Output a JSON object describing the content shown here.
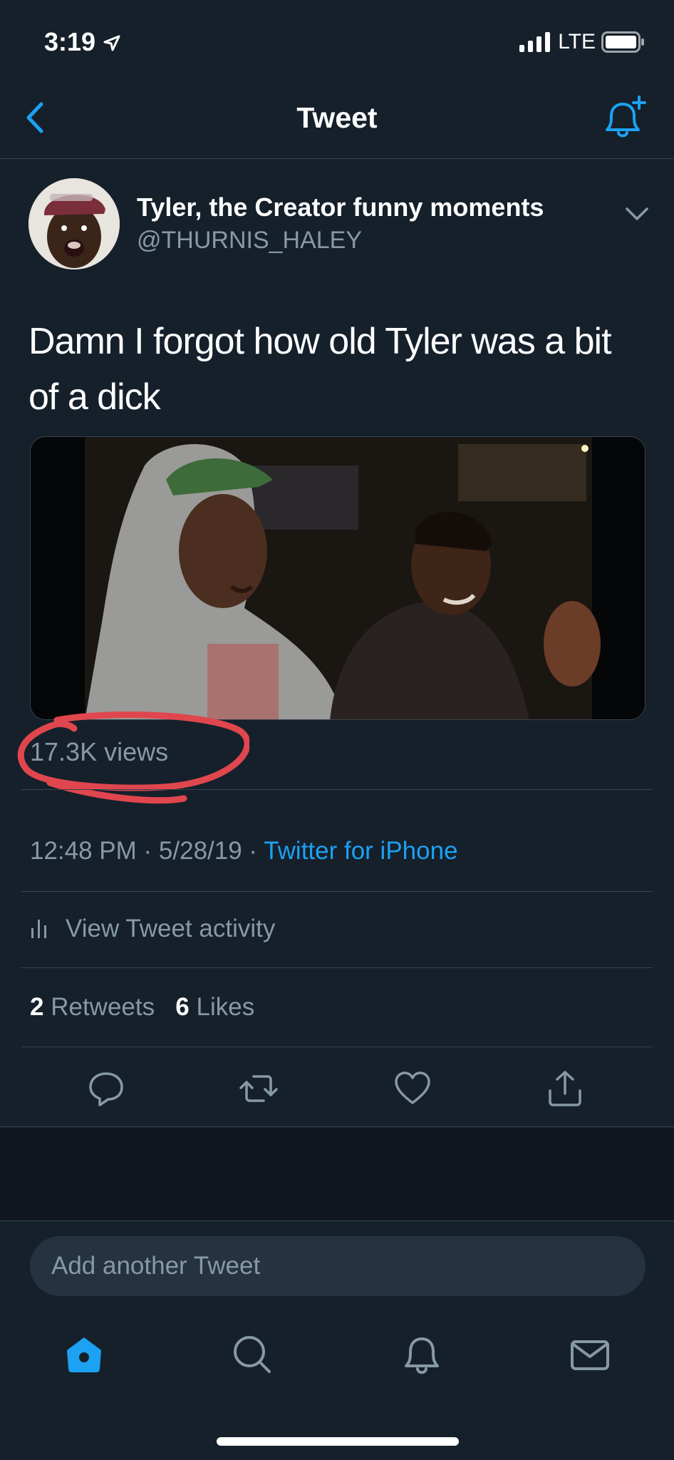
{
  "status_bar": {
    "time": "3:19",
    "network": "LTE"
  },
  "nav": {
    "title": "Tweet"
  },
  "author": {
    "name": "Tyler, the Creator funny moments",
    "handle": "@THURNIS_HALEY"
  },
  "tweet": {
    "text": "Damn I forgot how old Tyler was a bit of a dick",
    "views": "17.3K views",
    "time": "12:48 PM",
    "date": "5/28/19",
    "source": "Twitter for iPhone",
    "activity_label": "View Tweet activity",
    "retweets_count": "2",
    "retweets_label": "Retweets",
    "likes_count": "6",
    "likes_label": "Likes"
  },
  "reply": {
    "placeholder": "Add another Tweet"
  },
  "colors": {
    "background": "#15202b",
    "accent": "#1da1f2",
    "secondary_text": "#8899a6",
    "annotation": "#e0464e"
  },
  "icons": [
    "back-chevron-icon",
    "bell-plus-icon",
    "chevron-down-icon",
    "bar-chart-icon",
    "reply-icon",
    "retweet-icon",
    "like-icon",
    "share-icon",
    "home-icon",
    "search-icon",
    "notifications-icon",
    "messages-icon"
  ]
}
